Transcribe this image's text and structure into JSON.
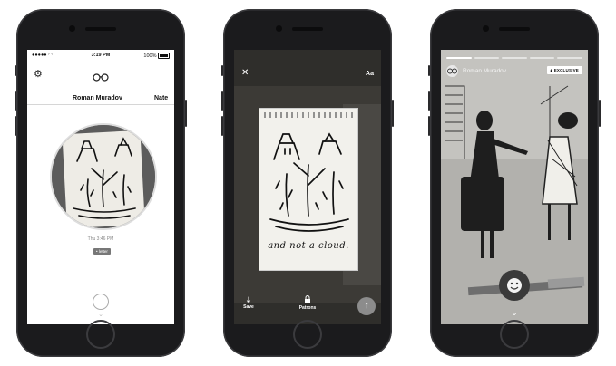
{
  "phone1": {
    "status": {
      "time": "3:19 PM",
      "battery": "100%"
    },
    "profile": {
      "name": "Roman Muradov",
      "next_name": "Nate"
    },
    "message": {
      "timestamp": "Thu 3:46 PM",
      "tag": "• letter"
    },
    "capture_button_label": "",
    "chevron": "⌄"
  },
  "phone2": {
    "close_icon": "✕",
    "text_tool_label": "Aa",
    "sketch_caption": "and not a cloud.",
    "actions": {
      "save": "Save",
      "patrons": "Patrons"
    },
    "send_icon": "↑"
  },
  "phone3": {
    "username": "Roman Muradov",
    "badge": "EXCLUSIVE",
    "progress_segments": 5,
    "progress_done": 1,
    "chevron": "⌄"
  },
  "icons": {
    "gear": "gear-icon",
    "logo": "glasses-logo-icon",
    "close": "close-icon",
    "save": "download-icon",
    "patrons": "lock-icon",
    "send": "arrow-up-icon",
    "lock_badge": "lock-icon",
    "reaction": "smile-icon",
    "chevron": "chevron-down-icon"
  },
  "colors": {
    "phone_body": "#1b1b1d",
    "screen1_bg": "#ffffff",
    "send_button": "#8c8c8c",
    "badge_bg": "#ffffff"
  }
}
